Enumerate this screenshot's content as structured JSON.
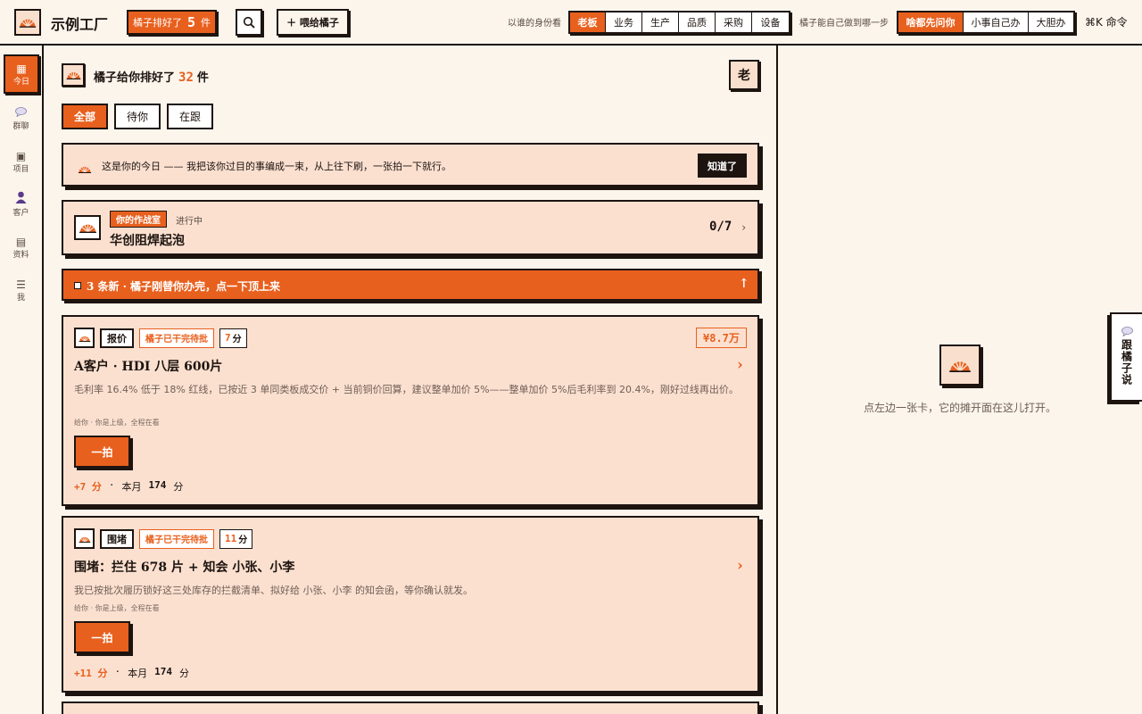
{
  "app": {
    "name": "示例工厂",
    "count_prefix": "橘子排好了",
    "count_value": "5",
    "count_suffix": "件",
    "feed_label": "＋ 喂给橘子"
  },
  "role_switch": {
    "label": "以谁的身份看",
    "options": [
      "老板",
      "业务",
      "生产",
      "品质",
      "采购",
      "设备"
    ],
    "active": "老板"
  },
  "autonomy_switch": {
    "label": "橘子能自己做到哪一步",
    "options": [
      "啥都先问你",
      "小事自己办",
      "大胆办"
    ],
    "active": "啥都先问你"
  },
  "command": "⌘K 命令",
  "sidebar": {
    "items": [
      {
        "label": "今日",
        "icon": "grid-icon",
        "active": true
      },
      {
        "label": "群聊",
        "icon": "chat-icon",
        "active": false
      },
      {
        "label": "项目",
        "icon": "project-icon",
        "active": false
      },
      {
        "label": "客户",
        "icon": "user-icon",
        "active": false
      },
      {
        "label": "资料",
        "icon": "docs-icon",
        "active": false
      },
      {
        "label": "我",
        "icon": "menu-icon",
        "active": false
      }
    ]
  },
  "header": {
    "title_prefix": "橘子给你排好了",
    "title_count": "32",
    "title_suffix": "件",
    "avatar_label": "老"
  },
  "filters": [
    "全部",
    "待你",
    "在跟"
  ],
  "notice": {
    "text": "这是你的今日 —— 我把该你过目的事编成一束，从上往下刷，一张拍一下就行。",
    "button": "知道了"
  },
  "war_room": {
    "tag": "你的作战室",
    "status": "进行中",
    "name": "华创阻焊起泡",
    "progress": "0/7"
  },
  "banner": {
    "text": "3 条新 · 橘子刚替你办完，点一下顶上来"
  },
  "tasks": [
    {
      "type": "报价",
      "state": "橘子已干完待批",
      "score": "7",
      "score_unit": "分",
      "amount": "¥8.7万",
      "title": "A客户 · HDI 八层 600片",
      "desc": "毛利率 16.4% 低于 18% 红线，已按近 3 单同类板成交价 + 当前铜价回算，建议整单加价 5%——整单加价 5%后毛利率到 20.4%，刚好过线再出价。",
      "meta": "给你 · 你是上级，全程在看",
      "action": "一拍",
      "plus": "+7 分",
      "dot": "·",
      "month_label": "本月",
      "month_value": "174",
      "month_unit": "分"
    },
    {
      "type": "围堵",
      "state": "橘子已干完待批",
      "score": "11",
      "score_unit": "分",
      "amount": "",
      "title": "围堵：拦住 678 片 + 知会 小张、小李",
      "desc": "我已按批次履历锁好这三处库存的拦截清单、拟好给 小张、小李 的知会函，等你确认就发。",
      "meta": "给你 · 你是上级，全程在看",
      "action": "一拍",
      "plus": "+11 分",
      "dot": "·",
      "month_label": "本月",
      "month_value": "174",
      "month_unit": "分"
    }
  ],
  "right_panel": {
    "hint": "点左边一张卡，它的摊开面在这儿打开。",
    "chat_tab": "跟橘子说"
  },
  "colors": {
    "accent": "#e8601e",
    "ink": "#1d1410",
    "paper": "#fbf5ec",
    "card": "#fbe0d0"
  }
}
